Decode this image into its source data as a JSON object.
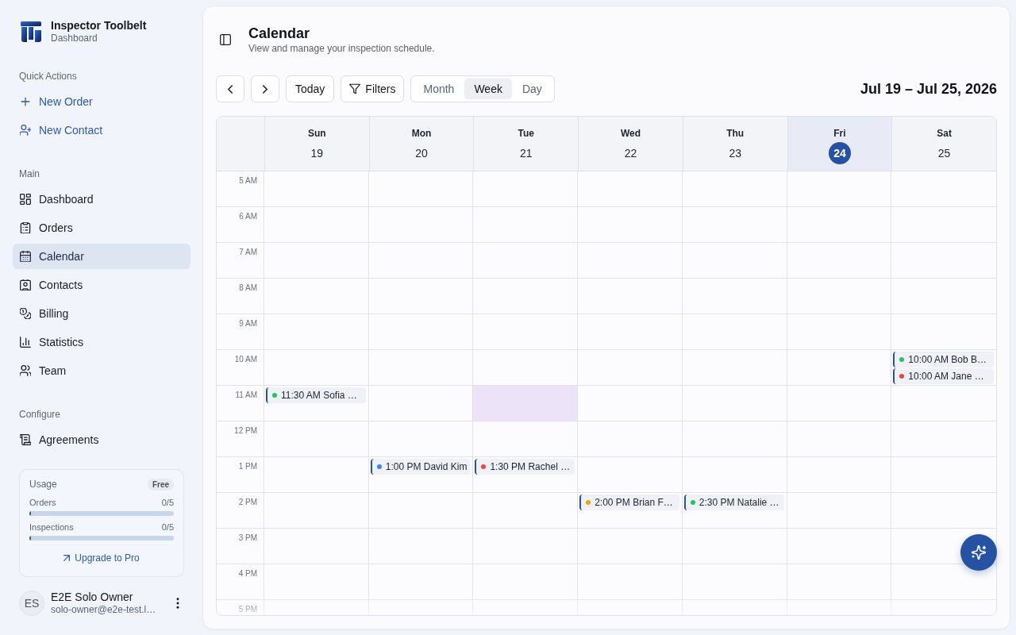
{
  "sidebar": {
    "brand": {
      "name": "Inspector Toolbelt",
      "subtitle": "Dashboard"
    },
    "sections": [
      {
        "title": "Quick Actions",
        "items": [
          {
            "label": "New Order",
            "kind": "action",
            "selected": false
          },
          {
            "label": "New Contact",
            "kind": "action",
            "selected": false
          }
        ]
      },
      {
        "title": "Main",
        "items": [
          {
            "label": "Dashboard",
            "kind": "link",
            "selected": false
          },
          {
            "label": "Orders",
            "kind": "link",
            "selected": false
          },
          {
            "label": "Calendar",
            "kind": "link",
            "selected": true
          },
          {
            "label": "Contacts",
            "kind": "link",
            "selected": false
          },
          {
            "label": "Billing",
            "kind": "link",
            "selected": false
          },
          {
            "label": "Statistics",
            "kind": "link",
            "selected": false
          },
          {
            "label": "Team",
            "kind": "link",
            "selected": false
          }
        ]
      },
      {
        "title": "Configure",
        "items": [
          {
            "label": "Agreements",
            "kind": "link",
            "selected": false
          }
        ]
      }
    ],
    "usage": {
      "title": "Usage",
      "plan": "Free",
      "meters": [
        {
          "label": "Orders",
          "reading": "0/5",
          "level": 0
        },
        {
          "label": "Inspections",
          "reading": "0/5",
          "level": 0
        }
      ],
      "upgrade_link": "Upgrade to Pro"
    },
    "user": {
      "initials": "ES",
      "name": "E2E Solo Owner",
      "email": "solo-owner@e2e-test.l…"
    }
  },
  "header": {
    "title": "Calendar",
    "subtitle": "View and manage your inspection schedule."
  },
  "toolbar": {
    "today_button": "Today",
    "filters_button": "Filters",
    "views": [
      {
        "label": "Month",
        "selected": false
      },
      {
        "label": "Week",
        "selected": true
      },
      {
        "label": "Day",
        "selected": false
      }
    ],
    "date_range": "Jul 19 – Jul 25, 2026"
  },
  "calendar": {
    "days": [
      {
        "name": "Sun",
        "date": "19",
        "today": false
      },
      {
        "name": "Mon",
        "date": "20",
        "today": false
      },
      {
        "name": "Tue",
        "date": "21",
        "today": false
      },
      {
        "name": "Wed",
        "date": "22",
        "today": false
      },
      {
        "name": "Thu",
        "date": "23",
        "today": false
      },
      {
        "name": "Fri",
        "date": "24",
        "today": true
      },
      {
        "name": "Sat",
        "date": "25",
        "today": false
      }
    ],
    "rows": [
      {
        "time": "5 AM",
        "cells": [
          {
            "hovered": false
          },
          {
            "hovered": false
          },
          {
            "hovered": false
          },
          {
            "hovered": false
          },
          {
            "hovered": false
          },
          {
            "hovered": false
          },
          {
            "hovered": false
          }
        ]
      },
      {
        "time": "6 AM",
        "cells": [
          {
            "hovered": false
          },
          {
            "hovered": false
          },
          {
            "hovered": false
          },
          {
            "hovered": false
          },
          {
            "hovered": false
          },
          {
            "hovered": false
          },
          {
            "hovered": false
          }
        ]
      },
      {
        "time": "7 AM",
        "cells": [
          {
            "hovered": false
          },
          {
            "hovered": false
          },
          {
            "hovered": false
          },
          {
            "hovered": false
          },
          {
            "hovered": false
          },
          {
            "hovered": false
          },
          {
            "hovered": false
          }
        ]
      },
      {
        "time": "8 AM",
        "cells": [
          {
            "hovered": false
          },
          {
            "hovered": false
          },
          {
            "hovered": false
          },
          {
            "hovered": false
          },
          {
            "hovered": false
          },
          {
            "hovered": false
          },
          {
            "hovered": false
          }
        ]
      },
      {
        "time": "9 AM",
        "cells": [
          {
            "hovered": false
          },
          {
            "hovered": false
          },
          {
            "hovered": false
          },
          {
            "hovered": false
          },
          {
            "hovered": false
          },
          {
            "hovered": false
          },
          {
            "hovered": false
          }
        ]
      },
      {
        "time": "10 AM",
        "cells": [
          {
            "hovered": false
          },
          {
            "hovered": false
          },
          {
            "hovered": false
          },
          {
            "hovered": false
          },
          {
            "hovered": false
          },
          {
            "hovered": false
          },
          {
            "hovered": false,
            "events": [
              {
                "label": "10:00 AM Bob B…",
                "color": "#22c55e"
              },
              {
                "label": "10:00 AM Jane …",
                "color": "#ef4444"
              }
            ]
          }
        ]
      },
      {
        "time": "11 AM",
        "cells": [
          {
            "hovered": false,
            "events": [
              {
                "label": "11:30 AM Sofia …",
                "color": "#22c55e"
              }
            ]
          },
          {
            "hovered": false
          },
          {
            "hovered": true
          },
          {
            "hovered": false
          },
          {
            "hovered": false
          },
          {
            "hovered": false
          },
          {
            "hovered": false
          }
        ]
      },
      {
        "time": "12 PM",
        "cells": [
          {
            "hovered": false
          },
          {
            "hovered": false
          },
          {
            "hovered": false
          },
          {
            "hovered": false
          },
          {
            "hovered": false
          },
          {
            "hovered": false
          },
          {
            "hovered": false
          }
        ]
      },
      {
        "time": "1 PM",
        "cells": [
          {
            "hovered": false
          },
          {
            "hovered": false,
            "events": [
              {
                "label": "1:00 PM David Kim",
                "color": "#3b82f6"
              }
            ]
          },
          {
            "hovered": false,
            "events": [
              {
                "label": "1:30 PM Rachel …",
                "color": "#ef4444"
              }
            ]
          },
          {
            "hovered": false
          },
          {
            "hovered": false
          },
          {
            "hovered": false
          },
          {
            "hovered": false
          }
        ]
      },
      {
        "time": "2 PM",
        "cells": [
          {
            "hovered": false
          },
          {
            "hovered": false
          },
          {
            "hovered": false
          },
          {
            "hovered": false,
            "events": [
              {
                "label": "2:00 PM Brian F…",
                "color": "#f59e0b"
              }
            ]
          },
          {
            "hovered": false,
            "events": [
              {
                "label": "2:30 PM Natalie …",
                "color": "#22c55e"
              }
            ]
          },
          {
            "hovered": false
          },
          {
            "hovered": false
          }
        ]
      },
      {
        "time": "3 PM",
        "cells": [
          {
            "hovered": false
          },
          {
            "hovered": false
          },
          {
            "hovered": false
          },
          {
            "hovered": false
          },
          {
            "hovered": false
          },
          {
            "hovered": false
          },
          {
            "hovered": false
          }
        ]
      },
      {
        "time": "4 PM",
        "cells": [
          {
            "hovered": false
          },
          {
            "hovered": false
          },
          {
            "hovered": false
          },
          {
            "hovered": false
          },
          {
            "hovered": false
          },
          {
            "hovered": false
          },
          {
            "hovered": false
          }
        ]
      },
      {
        "time": "5 PM",
        "cells": [
          {
            "hovered": false
          },
          {
            "hovered": false
          },
          {
            "hovered": false
          },
          {
            "hovered": false
          },
          {
            "hovered": false
          },
          {
            "hovered": false
          },
          {
            "hovered": false
          }
        ]
      }
    ]
  }
}
